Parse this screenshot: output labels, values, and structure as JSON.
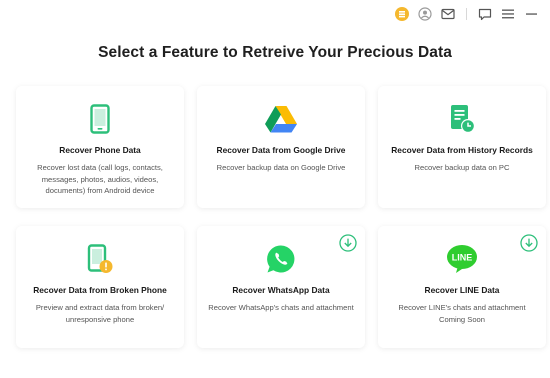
{
  "topbar": {
    "icons": [
      "upgrade-icon",
      "account-icon",
      "mail-icon",
      "feedback-icon",
      "menu-icon",
      "minimize-icon"
    ],
    "accent": "#f5b82e"
  },
  "page": {
    "title": "Select a Feature to Retreive Your Precious Data"
  },
  "cards": [
    {
      "title": "Recover Phone Data",
      "desc": "Recover lost data (call logs, contacts, messages, photos, audios, videos, documents) from Android device",
      "icon": "phone-icon",
      "color": "#2dbf7a"
    },
    {
      "title": "Recover Data from Google Drive",
      "desc": "Recover backup data on Google Drive",
      "icon": "google-drive-icon"
    },
    {
      "title": "Recover Data from History Records",
      "desc": "Recover backup data on PC",
      "icon": "history-records-icon",
      "color": "#2dbf7a"
    },
    {
      "title": "Recover Data from Broken Phone",
      "desc": "Preview and extract data from broken/ unresponsive phone",
      "icon": "broken-phone-icon",
      "color": "#2dbf7a"
    },
    {
      "title": "Recover WhatsApp Data",
      "desc": "Recover WhatsApp's chats and attachment",
      "icon": "whatsapp-icon",
      "color": "#25d366",
      "download": "download-icon"
    },
    {
      "title": "Recover LINE Data",
      "desc": "Recover LINE's chats and attachment Coming Soon",
      "icon": "line-icon",
      "color": "#2fcd2f",
      "badge": "LINE",
      "download": "download-icon"
    }
  ]
}
